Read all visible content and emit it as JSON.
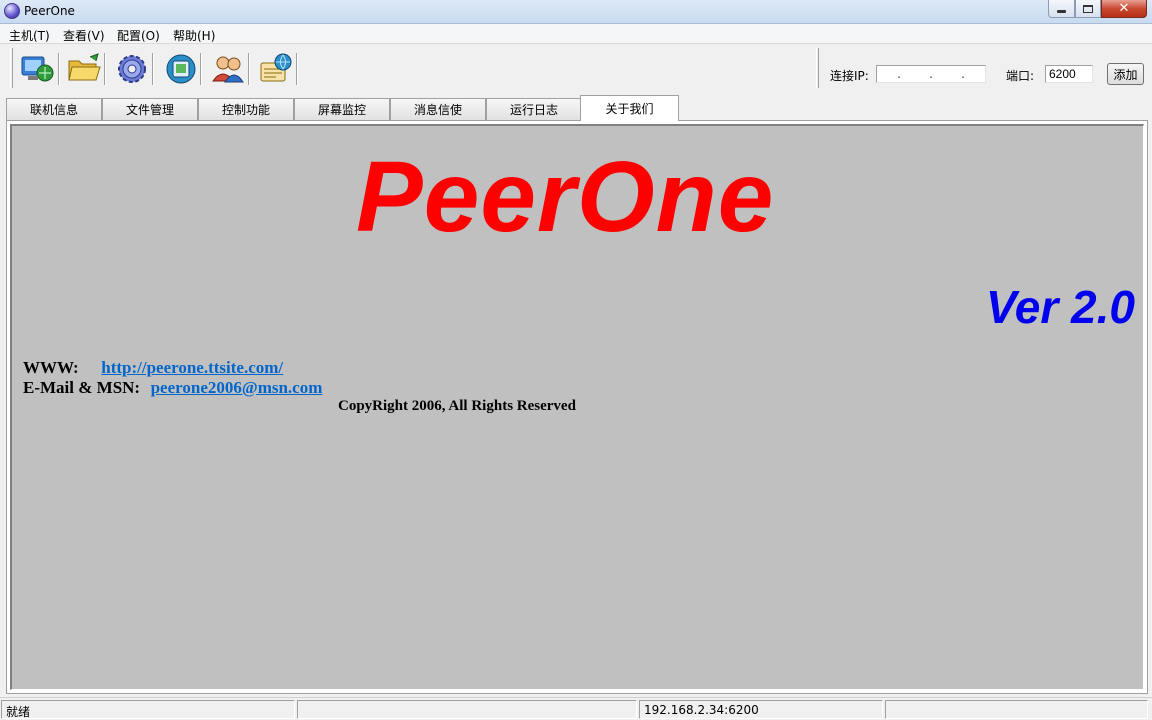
{
  "window": {
    "title": "PeerOne",
    "icon": "app-globe-icon"
  },
  "menu": [
    {
      "label": "主机(T)"
    },
    {
      "label": "查看(V)"
    },
    {
      "label": "配置(O)"
    },
    {
      "label": "帮助(H)"
    }
  ],
  "toolbar": {
    "buttons": [
      {
        "icon": "host-connect-icon"
      },
      {
        "icon": "open-folder-icon"
      },
      {
        "icon": "settings-gear-icon"
      },
      {
        "icon": "screen-monitor-icon"
      },
      {
        "icon": "users-icon"
      },
      {
        "icon": "web-log-icon"
      }
    ]
  },
  "connect": {
    "ip_label": "连接IP:",
    "ip_dots": [
      ".",
      ".",
      "."
    ],
    "port_label": "端口:",
    "port_value": "6200",
    "add_label": "添加"
  },
  "tabs": [
    {
      "label": "联机信息",
      "active": false
    },
    {
      "label": "文件管理",
      "active": false
    },
    {
      "label": "控制功能",
      "active": false
    },
    {
      "label": "屏幕监控",
      "active": false
    },
    {
      "label": "消息信使",
      "active": false
    },
    {
      "label": "运行日志",
      "active": false
    },
    {
      "label": "关于我们",
      "active": true
    }
  ],
  "about": {
    "product": "PeerOne",
    "version": "Ver 2.0",
    "www_label": "WWW:",
    "www_link": "http://peerone.ttsite.com/",
    "email_label": "E-Mail & MSN:",
    "email_link": "peerone2006@msn.com",
    "copyright": "CopyRight 2006, All Rights Reserved"
  },
  "status": {
    "state": "就绪",
    "address": "192.168.2.34:6200"
  },
  "colors": {
    "logo": "#ff0000",
    "version": "#0000ee",
    "link": "#0066cc",
    "panel_bg": "#c0c0c0"
  }
}
